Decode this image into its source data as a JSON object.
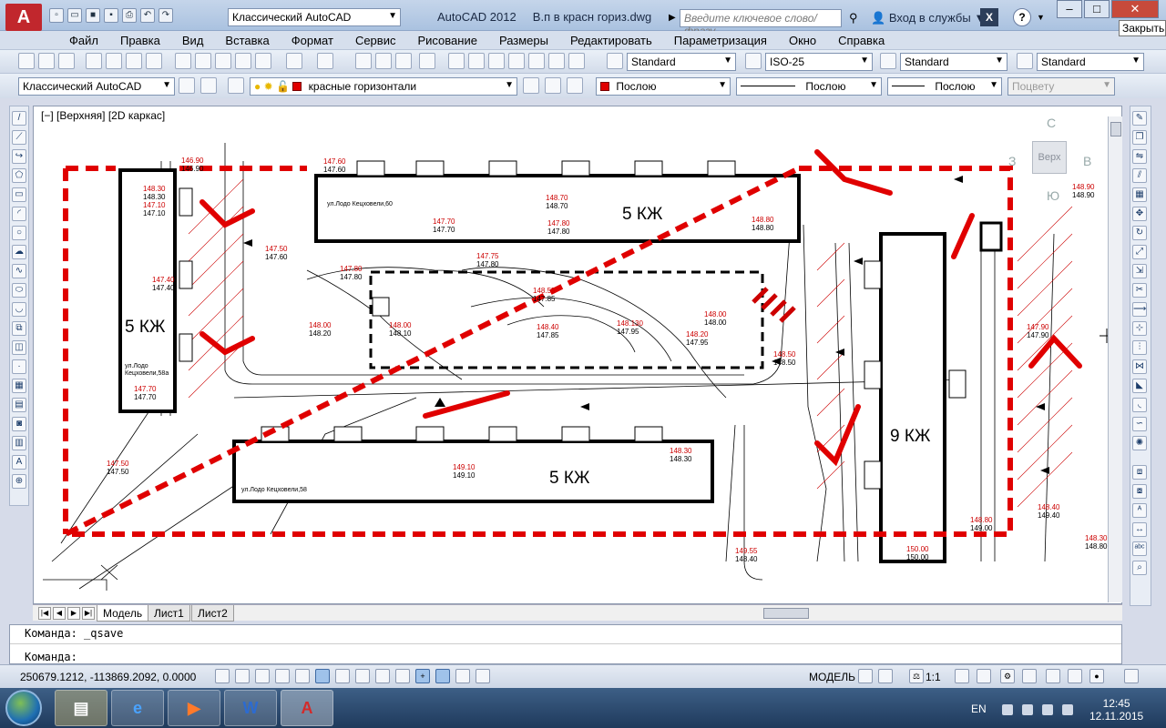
{
  "titlebar": {
    "workspace": "Классический AutoCAD",
    "app_name": "AutoCAD 2012",
    "file_name": "В.п в красн гориз.dwg",
    "search_placeholder": "Введите ключевое слово/фразу",
    "login": "Вход в службы",
    "close_tooltip": "Закрыть",
    "app_logo": "A"
  },
  "menu": [
    "Файл",
    "Правка",
    "Вид",
    "Вставка",
    "Формат",
    "Сервис",
    "Рисование",
    "Размеры",
    "Редактировать",
    "Параметризация",
    "Окно",
    "Справка"
  ],
  "styles_toolbar": {
    "text_style": "Standard",
    "dim_style": "ISO-25",
    "table_style": "Standard",
    "mleader_style": "Standard"
  },
  "layers_toolbar": {
    "workspace": "Классический AutoCAD",
    "layer": "красные горизонтали",
    "color": "Послою",
    "linetype": "Послою",
    "lineweight": "Послою",
    "plotstyle": "Поцвету"
  },
  "viewport": {
    "label": "[−] [Верхняя] [2D каркас]",
    "viewcube_top": "Верх",
    "compass_n": "С",
    "compass_s": "Ю",
    "compass_w": "З",
    "compass_e": "В"
  },
  "drawing": {
    "buildings": [
      {
        "label": "5 КЖ",
        "address": "ул.Лодо Кецховели,58а"
      },
      {
        "label": "5 КЖ",
        "address": "ул.Лодо Кецховели,60"
      },
      {
        "label": "5 КЖ",
        "address": "ул.Лодо Кецховели,58"
      },
      {
        "label": "9 КЖ",
        "address": ""
      }
    ],
    "elevations": [
      {
        "red": "146.90",
        "black": "146.90"
      },
      {
        "red": "148.30",
        "black": "148.30"
      },
      {
        "red": "147.10",
        "black": "147.10"
      },
      {
        "red": "147.60",
        "black": "147.60"
      },
      {
        "red": "148.70",
        "black": "148.70"
      },
      {
        "red": "147.70",
        "black": "147.70"
      },
      {
        "red": "147.80",
        "black": "147.80"
      },
      {
        "red": "148.80",
        "black": "148.80"
      },
      {
        "red": "147.50",
        "black": "147.60"
      },
      {
        "red": "147.75",
        "black": "147.80"
      },
      {
        "red": "147.80",
        "black": "147.80"
      },
      {
        "red": "148.55",
        "black": "147.85"
      },
      {
        "red": "148.00",
        "black": "148.20"
      },
      {
        "red": "148.00",
        "black": "148.10"
      },
      {
        "red": "148.40",
        "black": "147.85"
      },
      {
        "red": "148.130",
        "black": "147.95"
      },
      {
        "red": "148.20",
        "black": "147.95"
      },
      {
        "red": "148.00",
        "black": "148.00"
      },
      {
        "red": "147.40",
        "black": "147.40"
      },
      {
        "red": "147.70",
        "black": "147.70"
      },
      {
        "red": "147.50",
        "black": "147.50"
      },
      {
        "red": "149.10",
        "black": "149.10"
      },
      {
        "red": "148.30",
        "black": "148.30"
      },
      {
        "red": "148.80",
        "black": "149.00"
      },
      {
        "red": "148.40",
        "black": "149.40"
      },
      {
        "red": "148.30",
        "black": "148.80"
      },
      {
        "red": "149.55",
        "black": "148.40"
      },
      {
        "red": "148.50",
        "black": "148.50"
      },
      {
        "red": "147.90",
        "black": "147.90"
      },
      {
        "red": "150.00",
        "black": "150.00"
      },
      {
        "red": "148.90",
        "black": "148.90"
      }
    ]
  },
  "layout_tabs": [
    "Модель",
    "Лист1",
    "Лист2"
  ],
  "command": {
    "history": "Команда:  _qsave",
    "prompt": "Команда:"
  },
  "status": {
    "coordinates": "250679.1212, -113869.2092, 0.0000",
    "model": "МОДЕЛЬ",
    "scale": "1:1"
  },
  "taskbar": {
    "lang": "EN",
    "time": "12:45",
    "date": "12.11.2015"
  }
}
